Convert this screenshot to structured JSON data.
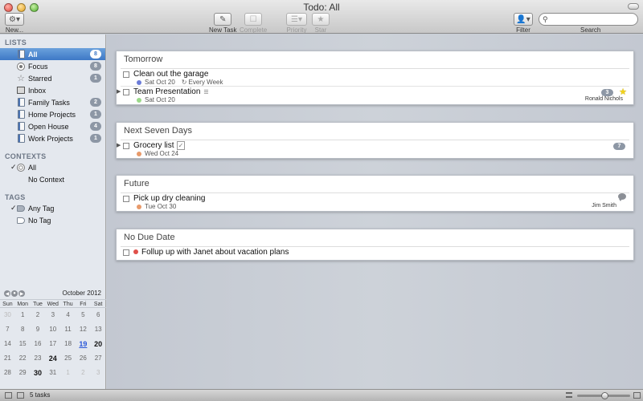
{
  "window": {
    "title": "Todo: All"
  },
  "toolbar": {
    "new_label": "New...",
    "new_task_label": "New Task",
    "complete_label": "Complete",
    "priority_label": "Priority",
    "star_label": "Star",
    "filter_label": "Filter",
    "search_label": "Search",
    "search_placeholder": ""
  },
  "sidebar": {
    "lists_header": "LISTS",
    "lists": [
      {
        "label": "All",
        "count": "8",
        "icon": "notebook-icon",
        "selected": true
      },
      {
        "label": "Focus",
        "count": "8",
        "icon": "focus-icon"
      },
      {
        "label": "Starred",
        "count": "1",
        "icon": "star-icon"
      },
      {
        "label": "Inbox",
        "count": "",
        "icon": "inbox-icon"
      },
      {
        "label": "Family Tasks",
        "count": "2",
        "icon": "notebook-icon"
      },
      {
        "label": "Home Projects",
        "count": "1",
        "icon": "notebook-icon"
      },
      {
        "label": "Open House",
        "count": "4",
        "icon": "notebook-icon"
      },
      {
        "label": "Work Projects",
        "count": "1",
        "icon": "notebook-icon"
      }
    ],
    "contexts_header": "CONTEXTS",
    "contexts": [
      {
        "label": "All",
        "checked": true
      },
      {
        "label": "No Context",
        "checked": false
      }
    ],
    "tags_header": "TAGS",
    "tags": [
      {
        "label": "Any Tag",
        "checked": true
      },
      {
        "label": "No Tag",
        "checked": false
      }
    ]
  },
  "calendar": {
    "month": "October 2012",
    "weekdays": [
      "Sun",
      "Mon",
      "Tue",
      "Wed",
      "Thu",
      "Fri",
      "Sat"
    ],
    "weeks": [
      [
        "30",
        "1",
        "2",
        "3",
        "4",
        "5",
        "6"
      ],
      [
        "7",
        "8",
        "9",
        "10",
        "11",
        "12",
        "13"
      ],
      [
        "14",
        "15",
        "16",
        "17",
        "18",
        "19",
        "20"
      ],
      [
        "21",
        "22",
        "23",
        "24",
        "25",
        "26",
        "27"
      ],
      [
        "28",
        "29",
        "30",
        "31",
        "1",
        "2",
        "3"
      ]
    ]
  },
  "sections": [
    {
      "title": "Tomorrow",
      "tasks": [
        {
          "title": "Clean out the garage",
          "date": "Sat Oct 20",
          "repeat": "Every Week",
          "dot_color": "#6b7bd8"
        },
        {
          "title": "Team Presentation",
          "date": "Sat Oct 20",
          "dot_color": "#9bd98a",
          "subtasks": "3",
          "assignee": "Ronald Nichols",
          "starred": true
        }
      ]
    },
    {
      "title": "Next Seven Days",
      "tasks": [
        {
          "title": "Grocery list",
          "date": "Wed Oct 24",
          "dot_color": "#e89a6a",
          "subtasks": "7"
        }
      ]
    },
    {
      "title": "Future",
      "tasks": [
        {
          "title": "Pick up dry cleaning",
          "date": "Tue Oct 30",
          "dot_color": "#e89a6a",
          "assignee": "Jim Smith"
        }
      ]
    },
    {
      "title": "No Due Date",
      "tasks": [
        {
          "title": "Follup up with Janet about vacation plans",
          "dot_color": "#e0504a"
        }
      ]
    }
  ],
  "status": {
    "text": "5 tasks"
  }
}
